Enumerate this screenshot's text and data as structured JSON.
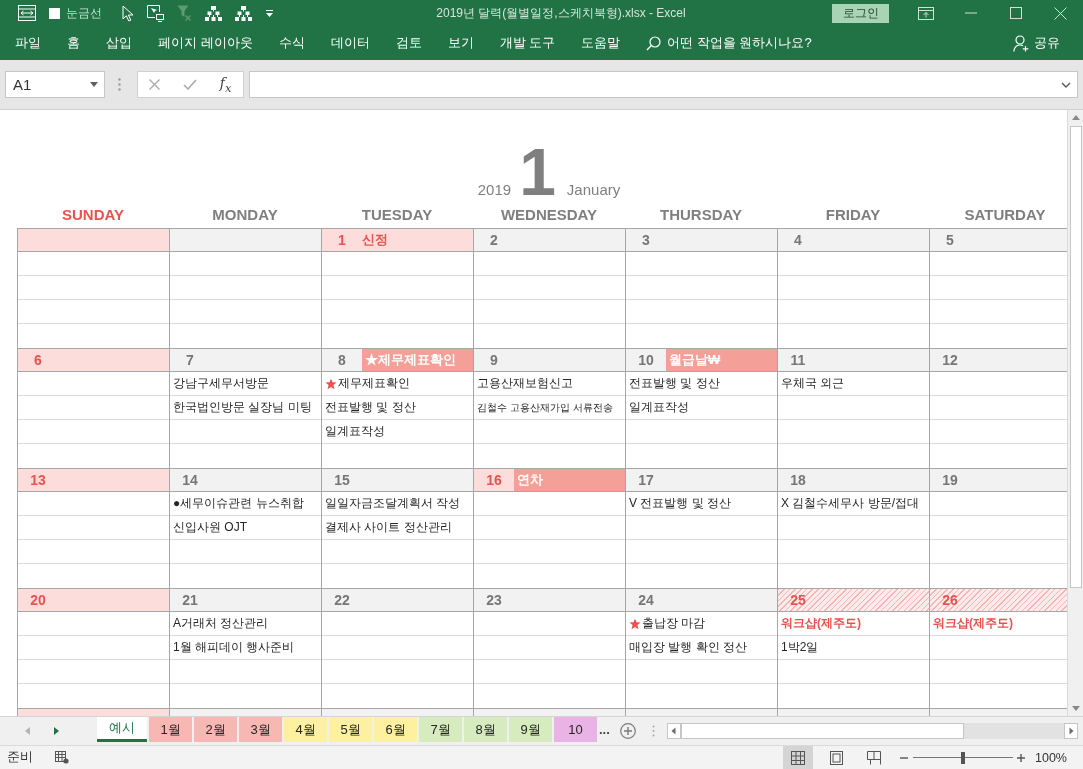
{
  "title_bar": {
    "gridlines": {
      "label": "눈금선",
      "checked": false
    },
    "title": "2019년 달력(월별일정,스케치북형).xlsx - Excel",
    "login": "로그인"
  },
  "ribbon": {
    "tabs": [
      "파일",
      "홈",
      "삽입",
      "페이지 레이아웃",
      "수식",
      "데이터",
      "검토",
      "보기",
      "개발 도구",
      "도움말"
    ],
    "tell_me": "어떤 작업을 원하시나요?",
    "share": "공유"
  },
  "formula_bar": {
    "name_box": "A1",
    "function_button": "f$_{x}$"
  },
  "calendar": {
    "year": "2019",
    "month": "1",
    "month_name": "January",
    "weekdays": [
      {
        "label": "SUNDAY",
        "kind": "holiday"
      },
      {
        "label": "MONDAY",
        "kind": "workday"
      },
      {
        "label": "TUESDAY",
        "kind": "workday"
      },
      {
        "label": "WEDNESDAY",
        "kind": "workday"
      },
      {
        "label": "THURSDAY",
        "kind": "workday"
      },
      {
        "label": "FRIDAY",
        "kind": "workday"
      },
      {
        "label": "SATURDAY",
        "kind": "workday"
      }
    ],
    "weeks": [
      {
        "days": [
          {
            "kind": "holiday"
          },
          {
            "kind": "workday"
          },
          {
            "kind": "holiday",
            "date": "1",
            "label": {
              "kind": "plain",
              "text": "신정"
            }
          },
          {
            "kind": "workday",
            "date": "2"
          },
          {
            "kind": "workday",
            "date": "3"
          },
          {
            "kind": "workday",
            "date": "4"
          },
          {
            "kind": "workday",
            "date": "5"
          }
        ]
      },
      {
        "days": [
          {
            "kind": "holiday",
            "date": "6"
          },
          {
            "kind": "workday",
            "date": "7",
            "tasks": [
              {
                "kind": "plain",
                "text": "강남구세무서방문"
              },
              {
                "kind": "plain",
                "text": "한국법인방문 실장님 미팅"
              }
            ]
          },
          {
            "kind": "workday",
            "date": "8",
            "label": {
              "kind": "badge",
              "text": "★제무제표확인"
            },
            "tasks": [
              {
                "kind": "starred",
                "text": "제무제표확인"
              },
              {
                "kind": "plain",
                "text": "전표발행 및 정산"
              },
              {
                "kind": "plain",
                "text": "일계표작성"
              }
            ]
          },
          {
            "kind": "workday",
            "date": "9",
            "tasks": [
              {
                "kind": "plain",
                "text": "고용산재보험신고"
              },
              {
                "kind": "fine",
                "text": "김철수 고용산재가입 서류전송"
              }
            ]
          },
          {
            "kind": "workday",
            "date": "10",
            "label": {
              "kind": "badge",
              "text": "월급날₩"
            },
            "tasks": [
              {
                "kind": "plain",
                "text": "전표발행 및 정산"
              },
              {
                "kind": "plain",
                "text": "일계표작성"
              }
            ]
          },
          {
            "kind": "workday",
            "date": "11",
            "tasks": [
              {
                "kind": "plain",
                "text": "우체국 외근"
              }
            ]
          },
          {
            "kind": "workday",
            "date": "12"
          }
        ]
      },
      {
        "days": [
          {
            "kind": "holiday",
            "date": "13"
          },
          {
            "kind": "workday",
            "date": "14",
            "tasks": [
              {
                "kind": "plain",
                "text": "●세무이슈관련 뉴스취합"
              },
              {
                "kind": "plain",
                "text": "신입사원 OJT"
              }
            ]
          },
          {
            "kind": "workday",
            "date": "15",
            "tasks": [
              {
                "kind": "plain",
                "text": "일일자금조달계획서 작성"
              },
              {
                "kind": "plain",
                "text": "결제사 사이트 정산관리"
              }
            ]
          },
          {
            "kind": "holiday",
            "date": "16",
            "label": {
              "kind": "badge",
              "text": "연차"
            }
          },
          {
            "kind": "workday",
            "date": "17",
            "tasks": [
              {
                "kind": "plain",
                "text": "V 전표발행 및 정산"
              }
            ]
          },
          {
            "kind": "workday",
            "date": "18",
            "tasks": [
              {
                "kind": "plain",
                "text": "X 김철수세무사 방문/접대"
              }
            ]
          },
          {
            "kind": "workday",
            "date": "19"
          }
        ]
      },
      {
        "days": [
          {
            "kind": "holiday",
            "date": "20"
          },
          {
            "kind": "workday",
            "date": "21",
            "tasks": [
              {
                "kind": "plain",
                "text": "A거래처 정산관리"
              },
              {
                "kind": "plain",
                "text": "1월 해피데이 행사준비"
              }
            ]
          },
          {
            "kind": "workday",
            "date": "22"
          },
          {
            "kind": "workday",
            "date": "23"
          },
          {
            "kind": "workday",
            "date": "24",
            "tasks": [
              {
                "kind": "starred",
                "text": "출납장 마감"
              },
              {
                "kind": "plain",
                "text": "매입장 발행 확인 정산"
              }
            ]
          },
          {
            "kind": "away",
            "date": "25",
            "tasks": [
              {
                "kind": "alert",
                "text": "워크샵(제주도)"
              },
              {
                "kind": "plain",
                "text": "1박2일"
              }
            ]
          },
          {
            "kind": "away",
            "date": "26",
            "tasks": [
              {
                "kind": "alert",
                "text": "워크샵(제주도)"
              }
            ]
          }
        ]
      },
      {
        "days": [
          {
            "kind": "holiday"
          },
          {
            "kind": "workday"
          },
          {
            "kind": "workday"
          },
          {
            "kind": "workday"
          },
          {
            "kind": "workday"
          },
          {
            "kind": "workday"
          },
          {
            "kind": "workday"
          }
        ]
      }
    ]
  },
  "sheet_tabs": {
    "tabs": [
      {
        "label": "예시",
        "selected": true,
        "color": "#217346"
      },
      {
        "label": "1월",
        "selected": false,
        "color": "#f7b7b3"
      },
      {
        "label": "2월",
        "selected": false,
        "color": "#f7b7b3"
      },
      {
        "label": "3월",
        "selected": false,
        "color": "#f7b7b3"
      },
      {
        "label": "4월",
        "selected": false,
        "color": "#fdf0a0"
      },
      {
        "label": "5월",
        "selected": false,
        "color": "#fdf0a0"
      },
      {
        "label": "6월",
        "selected": false,
        "color": "#fdf0a0"
      },
      {
        "label": "7월",
        "selected": false,
        "color": "#d6ecbe"
      },
      {
        "label": "8월",
        "selected": false,
        "color": "#d6ecbe"
      },
      {
        "label": "9월",
        "selected": false,
        "color": "#d6ecbe"
      },
      {
        "label": "10",
        "selected": false,
        "color": "#e9b3e6"
      }
    ],
    "more": "..."
  },
  "status_bar": {
    "status": "준비",
    "views": [
      {
        "kind": "normal",
        "selected": true
      },
      {
        "kind": "page_layout",
        "selected": false
      },
      {
        "kind": "page_break",
        "selected": false
      }
    ],
    "zoom": {
      "level": 0.5,
      "label": "100%"
    }
  }
}
